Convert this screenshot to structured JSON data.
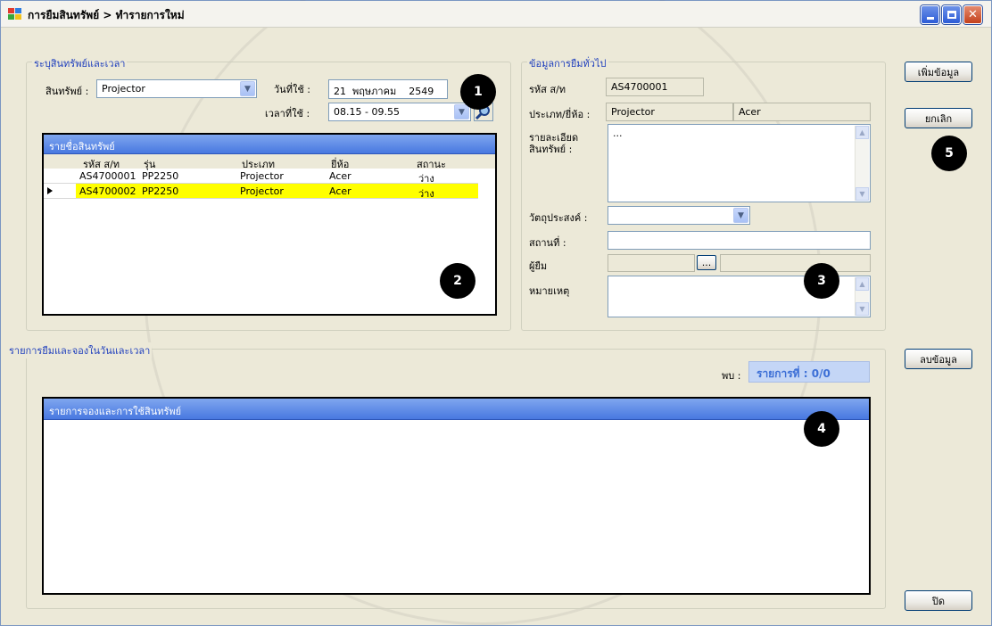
{
  "window": {
    "title": "การยืมสินทรัพย์ > ทำรายการใหม่",
    "minimize_icon": "minimize-icon",
    "maximize_icon": "maximize-icon",
    "close_icon": "close-icon"
  },
  "asset_group": {
    "title": "ระบุสินทรัพย์และเวลา",
    "asset_label": "สินทรัพย์ :",
    "asset_value": "Projector",
    "date_label": "วันที่ใช้ :",
    "date_day": "21",
    "date_month": "พฤษภาคม",
    "date_year": "2549",
    "time_label": "เวลาที่ใช้ :",
    "time_value": "08.15 - 09.55",
    "search_icon": "search-icon"
  },
  "asset_list": {
    "caption": "รายชื่อสินทรัพย์",
    "columns": [
      "รหัส ส/ท",
      "รุ่น",
      "ประเภท",
      "ยี่ห้อ",
      "สถานะ"
    ],
    "rows": [
      {
        "code": "AS4700001",
        "model": "PP2250",
        "type": "Projector",
        "brand": "Acer",
        "status": "ว่าง"
      },
      {
        "code": "AS4700002",
        "model": "PP2250",
        "type": "Projector",
        "brand": "Acer",
        "status": "ว่าง"
      }
    ],
    "selected_row": 1
  },
  "general_info": {
    "title": "ข้อมูลการยืมทั่วไป",
    "code_label": "รหัส ส/ท",
    "code_value": "AS4700001",
    "type_brand_label": "ประเภท/ยี่ห้อ :",
    "type_value": "Projector",
    "brand_value": "Acer",
    "detail_label_1": "รายละเอียด",
    "detail_label_2": "สินทรัพย์ :",
    "detail_value": "...",
    "purpose_label": "วัตถุประสงค์ :",
    "purpose_value": "",
    "place_label": "สถานที่ :",
    "place_value": "",
    "borrower_label": "ผู้ยืม",
    "borrower_button": "...",
    "note_label": "หมายเหตุ",
    "note_value": ""
  },
  "booking_group": {
    "title": "รายการยืมและจองในวันและเวลา",
    "found_label": "พบ :",
    "found_value": "รายการที่ : 0/0",
    "grid_caption": "รายการจองและการใช้สินทรัพย์"
  },
  "buttons": {
    "add": "เพิ่มข้อมูล",
    "cancel": "ยกเลิก",
    "delete": "ลบข้อมูล",
    "close": "ปิด"
  },
  "badges": [
    "1",
    "2",
    "3",
    "4",
    "5"
  ],
  "colors": {
    "grid_caption": "#4878e0",
    "selected_row": "#ffff00",
    "group_title": "#1f3fbd"
  }
}
